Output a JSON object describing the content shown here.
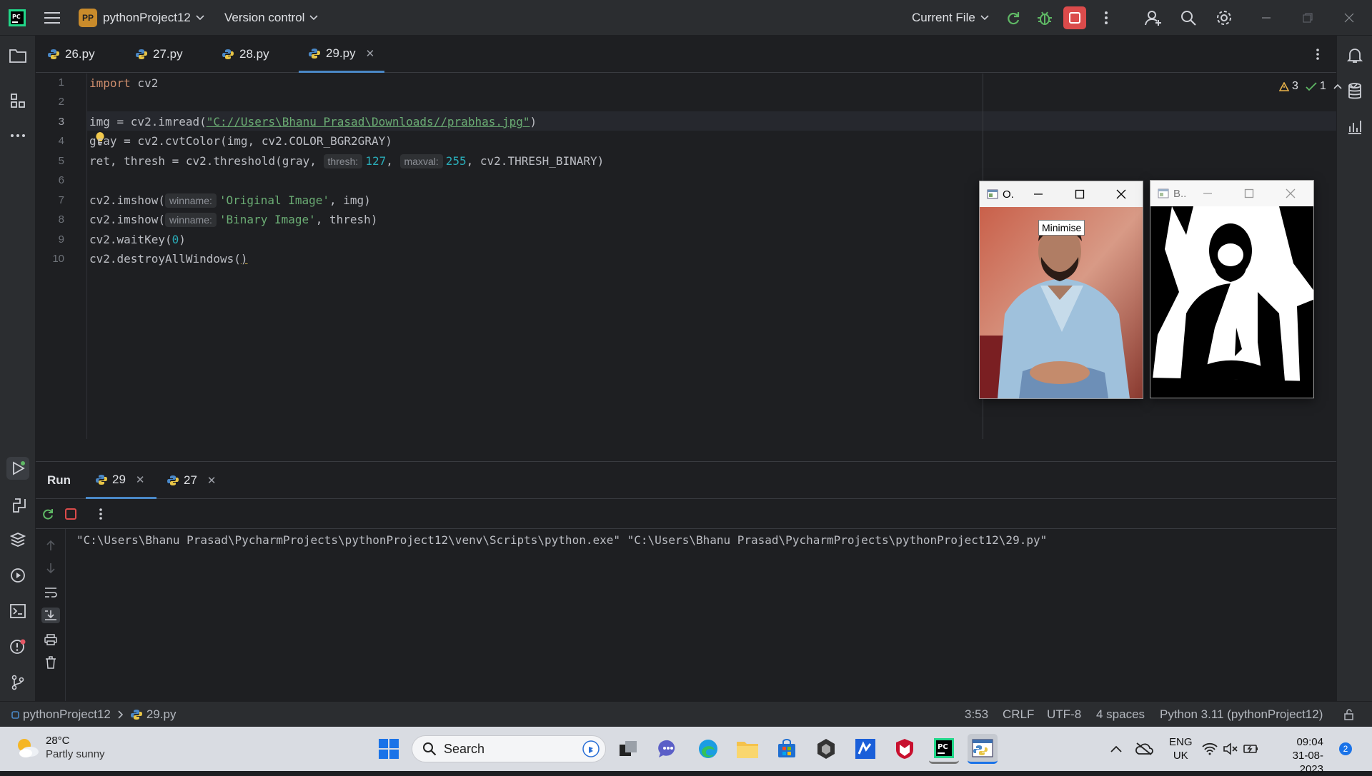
{
  "titlebar": {
    "project_badge": "PP",
    "project_name": "pythonProject12",
    "vcs": "Version control",
    "run_config": "Current File"
  },
  "tabs": [
    {
      "label": "26.py"
    },
    {
      "label": "27.py"
    },
    {
      "label": "28.py"
    },
    {
      "label": "29.py",
      "active": true
    }
  ],
  "editor": {
    "line_numbers": [
      "1",
      "2",
      "3",
      "4",
      "5",
      "6",
      "7",
      "8",
      "9",
      "10"
    ],
    "current_line": 3,
    "lines": {
      "l1_kw": "import",
      "l1_rest": " cv2",
      "l3_a": "img = cv2.imread(",
      "l3_str": "\"C://Users\\Bhanu Prasad\\Downloads//prabhas.jpg\"",
      "l3_b": ")",
      "l4": "gray = cv2.cvtColor(img, cv2.COLOR_BGR2GRAY)",
      "l5_a": "ret, thresh = cv2.threshold(gray, ",
      "l5_hint1": "thresh:",
      "l5_num1": "127",
      "l5_sep": ", ",
      "l5_hint2": "maxval:",
      "l5_num2": "255",
      "l5_b": ", cv2.THRESH_BINARY)",
      "l7_a": "cv2.imshow(",
      "l7_hint": "winname:",
      "l7_str": "'Original Image'",
      "l7_b": ", img)",
      "l8_a": "cv2.imshow(",
      "l8_hint": "winname:",
      "l8_str": "'Binary Image'",
      "l8_b": ", thresh)",
      "l9_a": "cv2.waitKey(",
      "l9_num": "0",
      "l9_b": ")",
      "l10_a": "cv2.destroyAllWindows(",
      "l10_b": ")"
    },
    "inspections": {
      "warnings": "3",
      "ok": "1"
    }
  },
  "cv_windows": [
    {
      "title": "O.",
      "tooltip": "Minimise"
    },
    {
      "title": "B.."
    }
  ],
  "run_panel": {
    "title": "Run",
    "tabs": [
      {
        "label": "29",
        "active": true
      },
      {
        "label": "27"
      }
    ],
    "console": "\"C:\\Users\\Bhanu Prasad\\PycharmProjects\\pythonProject12\\venv\\Scripts\\python.exe\" \"C:\\Users\\Bhanu Prasad\\PycharmProjects\\pythonProject12\\29.py\""
  },
  "statusbar": {
    "breadcrumb_project": "pythonProject12",
    "breadcrumb_file": "29.py",
    "position": "3:53",
    "line_ending": "CRLF",
    "encoding": "UTF-8",
    "indent": "4 spaces",
    "interpreter": "Python 3.11 (pythonProject12)"
  },
  "taskbar": {
    "weather_temp": "28°C",
    "weather_desc": "Partly sunny",
    "search_placeholder": "Search",
    "lang": "ENG",
    "region": "UK",
    "time": "09:04",
    "date": "31-08-2023",
    "notifications": "2"
  },
  "colors": {
    "accent": "#4a88c7",
    "bg_editor": "#1e1f22",
    "bg_panels": "#2b2d30",
    "keyword": "#cf8e6d",
    "string": "#6aab73",
    "number": "#2aacb8",
    "stop_red": "#db4b4b"
  }
}
